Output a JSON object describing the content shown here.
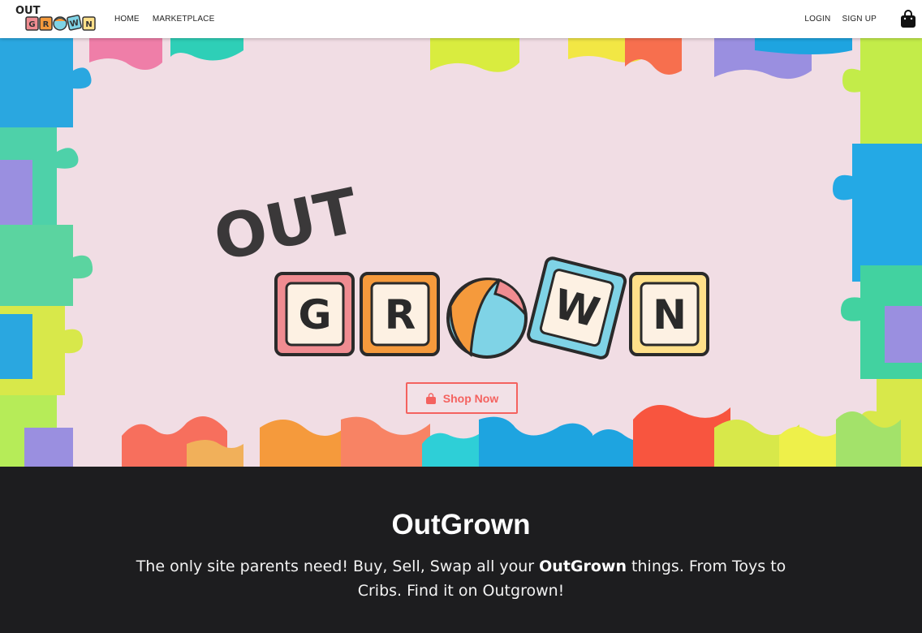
{
  "navbar": {
    "brand_out": "OUT",
    "brand_letters": [
      "G",
      "R",
      "W",
      "N"
    ],
    "links_left": [
      "HOME",
      "MARKETPLACE"
    ],
    "links_right": [
      "LOGIN",
      "SIGN UP"
    ],
    "cart_icon": "shopping-bag-icon"
  },
  "hero": {
    "logo_out": "OUT",
    "logo_letters": [
      "G",
      "R",
      "W",
      "N"
    ],
    "shop_button": "Shop Now",
    "shop_icon": "shopping-bag-icon"
  },
  "about": {
    "title": "OutGrown",
    "text_before": "The only site parents need! Buy, Sell, Swap all your ",
    "text_bold": "OutGrown",
    "text_after": " things. From Toys to Cribs. Find it on Outgrown!"
  },
  "colors": {
    "accent": "#f4625f",
    "dark": "#1d1d1f",
    "hero_bg": "#f1dde4",
    "block_pink": "#f08c91",
    "block_orange": "#f59a3c",
    "block_blue": "#7fd3e6",
    "block_yellow": "#ffe08a"
  }
}
